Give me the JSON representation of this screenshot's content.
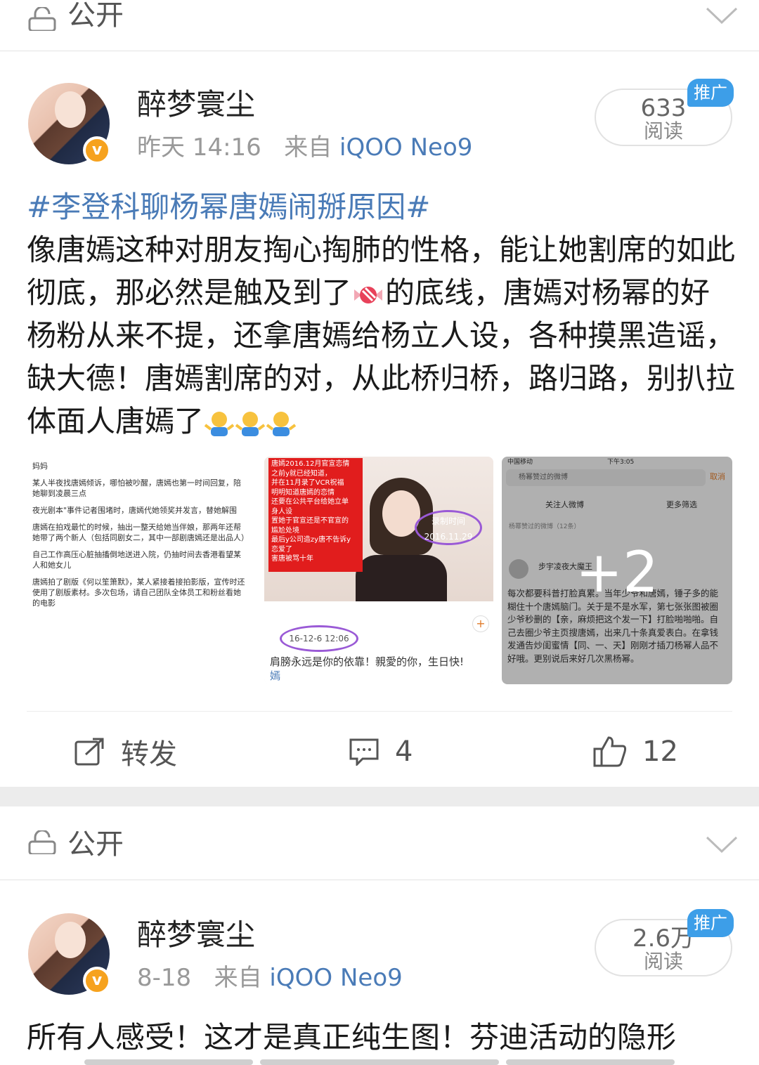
{
  "visibility_label": "公开",
  "posts": [
    {
      "username": "醉梦寰尘",
      "time": "昨天 14:16",
      "from_label": "来自",
      "device": "iQOO Neo9",
      "reads_count": "633",
      "reads_label": "阅读",
      "promo_label": "推广",
      "hashtag": "#李登科聊杨幂唐嫣闹掰原因#",
      "text_part1": "像唐嫣这种对朋友掏心掏肺的性格，能让她割席的如此彻底，那必然是触及到了",
      "text_part2": "的底线，唐嫣对杨幂的好杨粉从来不提，还拿唐嫣给杨立人设，各种摸黑造谣，缺大德！唐嫣割席的对，从此桥归桥，路归路，别扒拉体面人唐嫣了",
      "emoji_candy": "candy-icon",
      "emoji_shrug": "shrug-emoji",
      "images": {
        "img1_lines": [
          "妈妈",
          "某人半夜找唐嫣倾诉，哪怕被吵醒，唐嫣也第一时间回复，陪她聊到凌晨三点",
          "夜光剧本\"事件记者围堵时，唐嫣代她领奖并发言，替她解围",
          "唐嫣在拍戏最忙的时候，抽出一整天给她当伴娘，那两年还帮她带了两个新人（包括同剧女二，其中一部剧唐嫣还是出品人）",
          "自己工作高压心脏抽搐倒地送进入院，仍抽时间去香港看望某人和她女儿",
          "唐嫣拍了剧版《何以笙箫默》，某人紧接着接拍影版，宣传时还使用了剧版素材。多次包场，请自己团队全体员工和粉丝看她的电影"
        ],
        "img2_red_text": [
          "唐嫣2016.12月官宣恋情",
          "之前y就已经知道，",
          "并在11月录了VCR祝福",
          "明明知道唐嫣的恋情",
          "还要在公共平台给她立单",
          "身人设",
          "置她于官宣还是不官宣的",
          "尴尬处境",
          "最后y公司造zy唐不告诉y",
          "恋爱了",
          "害唐被骂十年"
        ],
        "img2_stamp": "录制时间 2016.11.29",
        "img2_date": "16-12-6 12:06",
        "img2_caption": "肩膀永远是你的依靠！親愛的你，生日快!",
        "img2_caption2": "嫣",
        "img3_status_carrier": "中国移动",
        "img3_status_time": "下午3:05",
        "img3_search": "杨幂赞过的微博",
        "img3_cancel": "取消",
        "img3_tab1": "关注人微博",
        "img3_tab2": "更多筛选",
        "img3_section": "杨幂赞过的微博（12条）",
        "img3_user": "步宇凌夜大魔王",
        "img3_body": "每次都要科普打脸真累。当年少爷和唐嫣，锤子多的能糊住十个唐嫣脑门。关于是不是水军，第七张张图被圈少爷秒删的【亲，麻烦把这个发一下】打脸啪啪啪。自己去圈少爷主页搜唐嫣，出来几十条真爱表白。在拿钱发通告炒闺蜜情【同、一、天】刚刚才插刀杨幂人品不好哦。更别说后来好几次黑杨幂。",
        "more_count": "+2"
      },
      "actions": {
        "repost_label": "转发",
        "comment_count": "4",
        "like_count": "12"
      }
    },
    {
      "username": "醉梦寰尘",
      "time": "8-18",
      "from_label": "来自",
      "device": "iQOO Neo9",
      "reads_count": "2.6万",
      "reads_label": "阅读",
      "promo_label": "推广",
      "text": "所有人感受！这才是真正纯生图！芬迪活动的隐形"
    }
  ]
}
